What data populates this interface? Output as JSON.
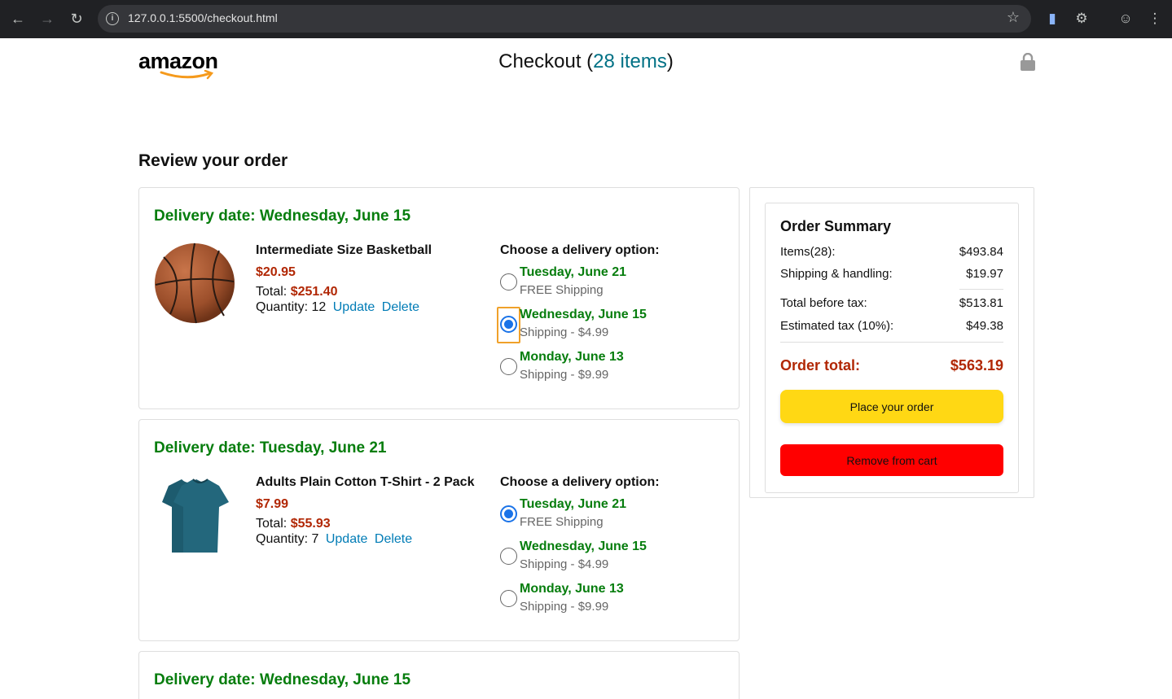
{
  "browser": {
    "url": "127.0.0.1:5500/checkout.html"
  },
  "header": {
    "logo_text": "amazon",
    "title_prefix": "Checkout (",
    "title_count": "28 items",
    "title_suffix": ")"
  },
  "review_heading": "Review your order",
  "cart_items": [
    {
      "delivery_date": "Delivery date: Wednesday, June 15",
      "name": "Intermediate Size Basketball",
      "price": "$20.95",
      "total_label": "Total:",
      "total_value": "$251.40",
      "quantity_label": "Quantity:",
      "quantity_value": "12",
      "update_label": "Update",
      "delete_label": "Delete",
      "options_title": "Choose a delivery option:",
      "options": [
        {
          "date": "Tuesday, June 21",
          "price": "FREE Shipping",
          "checked": false
        },
        {
          "date": "Wednesday, June 15",
          "price": "Shipping - $4.99",
          "checked": true
        },
        {
          "date": "Monday, June 13",
          "price": "Shipping - $9.99",
          "checked": false
        }
      ]
    },
    {
      "delivery_date": "Delivery date: Tuesday, June 21",
      "name": "Adults Plain Cotton T-Shirt - 2 Pack",
      "price": "$7.99",
      "total_label": "Total:",
      "total_value": "$55.93",
      "quantity_label": "Quantity:",
      "quantity_value": "7",
      "update_label": "Update",
      "delete_label": "Delete",
      "options_title": "Choose a delivery option:",
      "options": [
        {
          "date": "Tuesday, June 21",
          "price": "FREE Shipping",
          "checked": true
        },
        {
          "date": "Wednesday, June 15",
          "price": "Shipping - $4.99",
          "checked": false
        },
        {
          "date": "Monday, June 13",
          "price": "Shipping - $9.99",
          "checked": false
        }
      ]
    },
    {
      "delivery_date": "Delivery date: Wednesday, June 15"
    }
  ],
  "summary": {
    "title": "Order Summary",
    "items_label": "Items(28):",
    "items_value": "$493.84",
    "shipping_label": "Shipping & handling:",
    "shipping_value": "$19.97",
    "before_tax_label": "Total before tax:",
    "before_tax_value": "$513.81",
    "tax_label": "Estimated tax (10%):",
    "tax_value": "$49.38",
    "total_label": "Order total:",
    "total_value": "$563.19",
    "place_order_label": "Place your order",
    "remove_label": "Remove from cart"
  },
  "colors": {
    "delivery_green": "#067d0d",
    "price_red": "#b12704",
    "link_blue": "#017cb6",
    "place_button": "#ffd814",
    "remove_button": "#ff0000"
  }
}
